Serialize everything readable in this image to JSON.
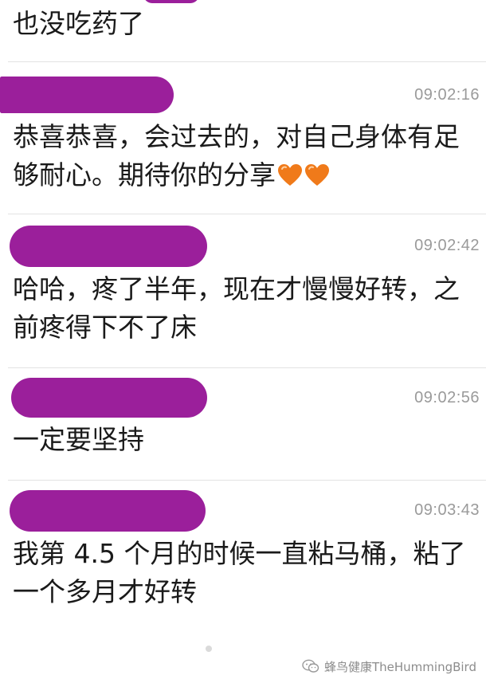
{
  "messages": [
    {
      "text": "也没吃药了"
    },
    {
      "time": "09:02:16",
      "text": "恭喜恭喜，会过去的，对自己身体有足够耐心。期待你的分享"
    },
    {
      "time": "09:02:42",
      "text": "哈哈，疼了半年，现在才慢慢好转，之前疼得下不了床"
    },
    {
      "time": "09:02:56",
      "text": "一定要坚持"
    },
    {
      "time": "09:03:43",
      "text": "我第 4.5 个月的时候一直粘马桶，粘了一个多月才好转"
    }
  ],
  "emoji": [
    "orange-heart",
    "orange-heart"
  ],
  "redaction_color": "#9b1f9b",
  "heart_color": "#f07a1a",
  "footer": {
    "watermark": "蜂鸟健康TheHummingBird"
  }
}
